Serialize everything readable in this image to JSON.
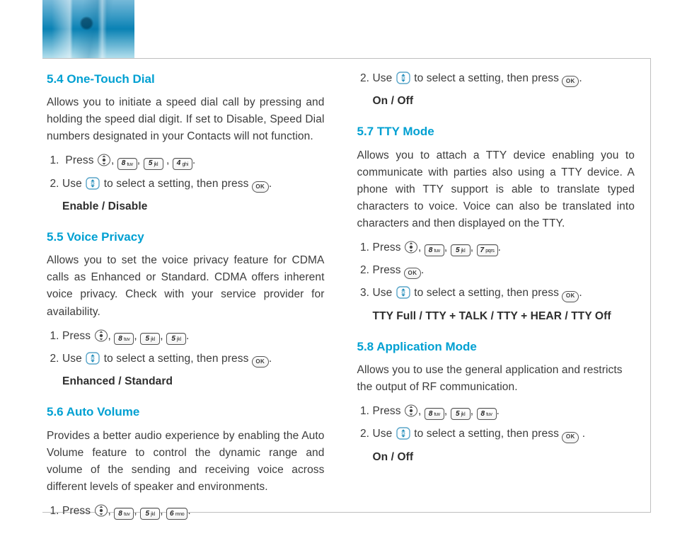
{
  "sections": {
    "s54": {
      "heading": "5.4 One-Touch Dial",
      "desc": "Allows you to initiate a speed dial call by pressing and holding the speed dial digit. If set to Disable, Speed Dial numbers designated in your Contacts will not function.",
      "step1_a": "Press ",
      "step2_a": "Use ",
      "step2_b": " to select a setting, then press ",
      "step2_c": ".",
      "options": "Enable / Disable"
    },
    "s55": {
      "heading": "5.5 Voice Privacy",
      "desc": "Allows you to set the voice privacy feature for CDMA calls as Enhanced or Standard. CDMA offers inherent voice privacy. Check with your service provider for availability.",
      "step1_a": "Press ",
      "step2_a": "Use ",
      "step2_b": " to select a setting, then press ",
      "step2_c": ".",
      "options": "Enhanced / Standard"
    },
    "s56": {
      "heading": "5.6 Auto Volume",
      "desc": "Provides a better audio experience by enabling the Auto Volume feature to control the dynamic range and volume of the sending and receiving voice across different levels of speaker and environments.",
      "step1_a": "Press ",
      "step2_a": "Use ",
      "step2_b": " to select a setting, then press ",
      "step2_c": ".",
      "options": "On / Off"
    },
    "s57": {
      "heading": "5.7 TTY Mode",
      "desc": "Allows you to attach a TTY device enabling you to communicate with parties also using a TTY device. A phone with TTY support is able to translate typed characters to voice. Voice can also be translated into characters and then displayed on the TTY.",
      "step1_a": "Press ",
      "step2_a": "Press ",
      "step2_b": ".",
      "step3_a": "Use ",
      "step3_b": " to select a setting, then press ",
      "step3_c": ".",
      "options": "TTY Full / TTY + TALK / TTY + HEAR / TTY Off"
    },
    "s58": {
      "heading": "5.8 Application Mode",
      "desc": "Allows you to use the general application and restricts the output of RF communication.",
      "step1_a": "Press ",
      "step2_a": "Use ",
      "step2_b": " to select a setting, then press ",
      "step2_c": ".",
      "options": "On / Off"
    }
  },
  "keys": {
    "k4": {
      "digit": "4",
      "sub": "ghi"
    },
    "k5": {
      "digit": "5",
      "sub": "jkl"
    },
    "k6": {
      "digit": "6",
      "sub": "mno"
    },
    "k7": {
      "digit": "7",
      "sub": "pqrs"
    },
    "k8": {
      "digit": "8",
      "sub": "tuv"
    },
    "ok": "OK"
  },
  "seq": {
    "s54": [
      "center",
      "k8",
      "k5",
      "k4"
    ],
    "s55": [
      "center",
      "k8",
      "k5",
      "k5"
    ],
    "s56": [
      "center",
      "k8",
      "k5",
      "k6"
    ],
    "s57": [
      "center",
      "k8",
      "k5",
      "k7"
    ],
    "s58": [
      "center",
      "k8",
      "k5",
      "k8"
    ]
  },
  "punct": {
    "comma": ", ",
    "period": "."
  }
}
